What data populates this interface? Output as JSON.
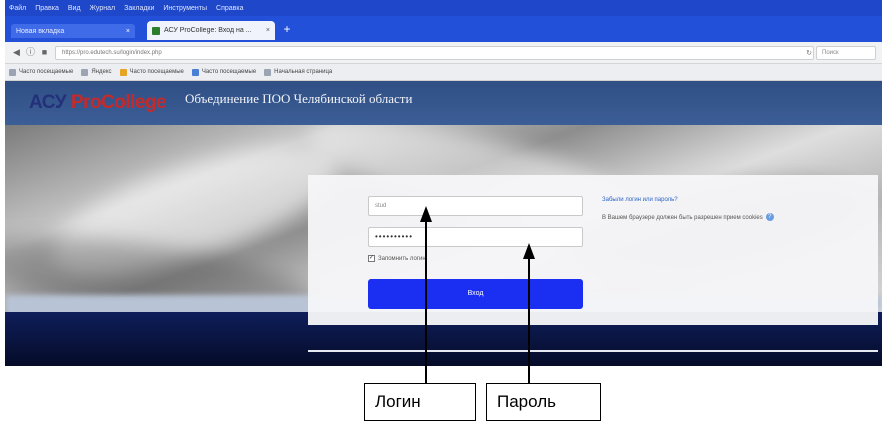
{
  "browser": {
    "menu": [
      "Файл",
      "Правка",
      "Вид",
      "Журнал",
      "Закладки",
      "Инструменты",
      "Справка"
    ],
    "tabs": [
      {
        "title": "Новая вкладка",
        "close": "×"
      },
      {
        "title": "АСУ ProCollege: Вход на ...",
        "close": "×"
      }
    ],
    "new_tab": "+",
    "url": "https://pro.edutech.su/login/index.php",
    "search_placeholder": "Поиск",
    "bookmarks": [
      {
        "label": "Часто посещаемые",
        "icon": "star-icon"
      },
      {
        "label": "Яндекс",
        "icon": "yandex-icon"
      },
      {
        "label": "Часто посещаемые",
        "icon": "folder-icon"
      },
      {
        "label": "Часто посещаемые",
        "icon": "folder-icon"
      },
      {
        "label": "Начальная страница",
        "icon": "home-icon"
      }
    ]
  },
  "site": {
    "logo_part1": "АСУ ",
    "logo_part2": "ProCollege",
    "title": "Объединение ПОО Челябинской области"
  },
  "login": {
    "username_value": "stud",
    "password_value": "••••••••••",
    "remember_label": "Запомнить логин",
    "submit_label": "Вход",
    "forgot_link": "Забыли логин или пароль?",
    "cookies_text": "В Вашем браузере должен быть разрешен прием cookies"
  },
  "annotations": {
    "login_label": "Логин",
    "password_label": "Пароль"
  },
  "colors": {
    "browser_chrome": "#2350d8",
    "site_header": "#3c5e96",
    "login_button": "#1b2ff2",
    "logo_accent": "#c42a2a"
  }
}
